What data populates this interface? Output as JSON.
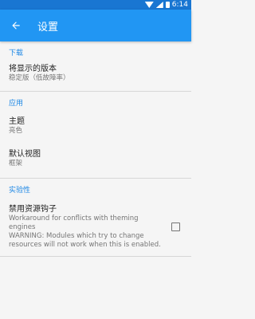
{
  "status_bar": {
    "time": "6:14",
    "icons": [
      "wifi-icon",
      "signal-icon",
      "battery-icon"
    ]
  },
  "app_bar": {
    "title": "设置",
    "back_icon": "arrow-back-icon"
  },
  "sections": [
    {
      "header": "下载",
      "items": [
        {
          "title": "将显示的版本",
          "subtitle": "稳定版（低故障率）"
        }
      ]
    },
    {
      "header": "应用",
      "items": [
        {
          "title": "主题",
          "subtitle": "亮色"
        },
        {
          "title": "默认视图",
          "subtitle": "框架"
        }
      ]
    },
    {
      "header": "实验性",
      "items": [
        {
          "title": "禁用资源钩子",
          "subtitle": "Workaround for conflicts with theming engines\nWARNING: Modules which try to change resources will not work when this is enabled.",
          "checked": false
        }
      ]
    }
  ],
  "colors": {
    "status_bar": "#1976d2",
    "app_bar": "#2196f3",
    "section_header": "#1e88e5",
    "background": "#f5f5f5"
  }
}
